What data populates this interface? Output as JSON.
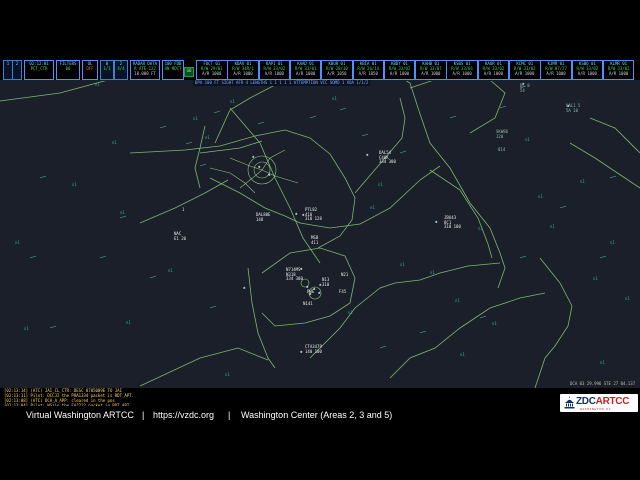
{
  "topbar": {
    "toggle_a": "1",
    "toggle_b": "2",
    "clock": {
      "a": "02:12:01",
      "b": "PCT_CTR",
      "c": ""
    },
    "filters": {
      "a": "FILTERS",
      "b": "00"
    },
    "ol": {
      "a": "OL",
      "b": "OFF"
    },
    "n1": {
      "a": "0",
      "b": "1/1"
    },
    "n2": {
      "a": "2",
      "b": "4/4"
    },
    "radar": {
      "a": "RADAR DATA",
      "b": "R ATE-122",
      "c": "18.000 FT"
    },
    "status": {
      "a": "100 FDB",
      "b": "ON MDCT"
    },
    "go": "GO",
    "airports": [
      {
        "a": "FDCT 01",
        "b": "R/W 29/01",
        "c": "A/R 1000"
      },
      {
        "a": "KDAV 01",
        "b": "R/W 34R/1",
        "c": "A/R 1000"
      },
      {
        "a": "KAPI 01",
        "b": "R/W 33/02",
        "c": "A/R 1000"
      },
      {
        "a": "KAAD 01",
        "b": "R/W 33/01",
        "c": "A/R 1000"
      },
      {
        "a": "KBUR 01",
        "b": "R/W 28/10",
        "c": "A/R 1050"
      },
      {
        "a": "KBIA 01",
        "b": "R/W 26/14",
        "c": "A/R 1050"
      },
      {
        "a": "KBDY 01",
        "b": "R/W 33/02",
        "c": "A/R 1000"
      },
      {
        "a": "KAHB 01",
        "b": "R/W 33/07",
        "c": "A/R 1000"
      },
      {
        "a": "KSBS 01",
        "b": "R/W 33/01",
        "c": "A/R 1000"
      },
      {
        "a": "KAUR 01",
        "b": "R/W 33/02",
        "c": "A/R 1000"
      },
      {
        "a": "KCMC 01",
        "b": "R/W 33/02",
        "c": "A/R 1000"
      },
      {
        "a": "KJMR 01",
        "b": "R/W 07/27",
        "c": "A/R 1000"
      },
      {
        "a": "KSBQ 01",
        "b": "R/W 33/02",
        "c": "A/R 1000"
      },
      {
        "a": "KLMR 01",
        "b": "R/W 33/02",
        "c": "A/R 1000"
      }
    ]
  },
  "info_line": "DPA 100 FT SIGHT AFR 4 LENGTHS 1 1 1 1 1 ATTEMPTION VCC SOMO 1 VOA 1/1/2",
  "scope": {
    "tags": [
      {
        "text": "NAC\nE1 20",
        "dim": false
      },
      {
        "text": "DL 8\n54",
        "dim": true
      },
      {
        "text": "UAL1 5\n5A 10",
        "dim": true
      },
      {
        "text": "DAL54\nC48K\n334 300",
        "dim": false
      },
      {
        "text": "N714MS\nN318\n334 300",
        "dim": false
      },
      {
        "text": "PTL82\n410\n310 128",
        "dim": false
      },
      {
        "text": "MSB\n411",
        "dim": false
      },
      {
        "text": "N13\n310",
        "dim": false
      },
      {
        "text": "DAL80E\n148",
        "dim": false
      },
      {
        "text": "JBU43\n8C1\n310 100",
        "dim": false
      },
      {
        "text": "N21",
        "dim": false
      },
      {
        "text": "F45",
        "dim": false
      },
      {
        "text": "N141",
        "dim": false
      },
      {
        "text": "CTA3479\n140 100",
        "dim": false
      },
      {
        "text": "SKW86\n120",
        "dim": true
      },
      {
        "text": "PWE",
        "dim": false
      },
      {
        "text": "014",
        "dim": true
      }
    ]
  },
  "messages": [
    "[02:13:14] (ATC) JAI_CL_CTR: DESC 8705009E TO JAI",
    "[02:13:11] Pilot: DCCJ2 the PRA1334 packet is RDT_APT.",
    "[02:13:08] (ATC) DCA_A_APP: cleared in the pos",
    "[02:13:04] Pilot: WSzip the FAJ222 packet in RDT_APT."
  ],
  "clock_readout": "DCA 03 29.996 STE 27 04.137",
  "footer": {
    "org": "Virtual Washington ARTCC",
    "sep1": "|",
    "url": "https://vzdc.org",
    "sep2": "|",
    "area": "Washington Center (Areas 2, 3 and 5)"
  },
  "logo": {
    "left": "ZDC",
    "right": "ARTCC",
    "sub": "WASHINGTON DC"
  },
  "colors": {
    "scope_bg": "#1b1f2a",
    "map_lines": "#8fd07a",
    "text_green": "#48d05a",
    "text_blue": "#7fd0ff",
    "message_yellow": "#ffd35a",
    "logo_blue": "#13306b",
    "logo_red": "#c81d25"
  }
}
